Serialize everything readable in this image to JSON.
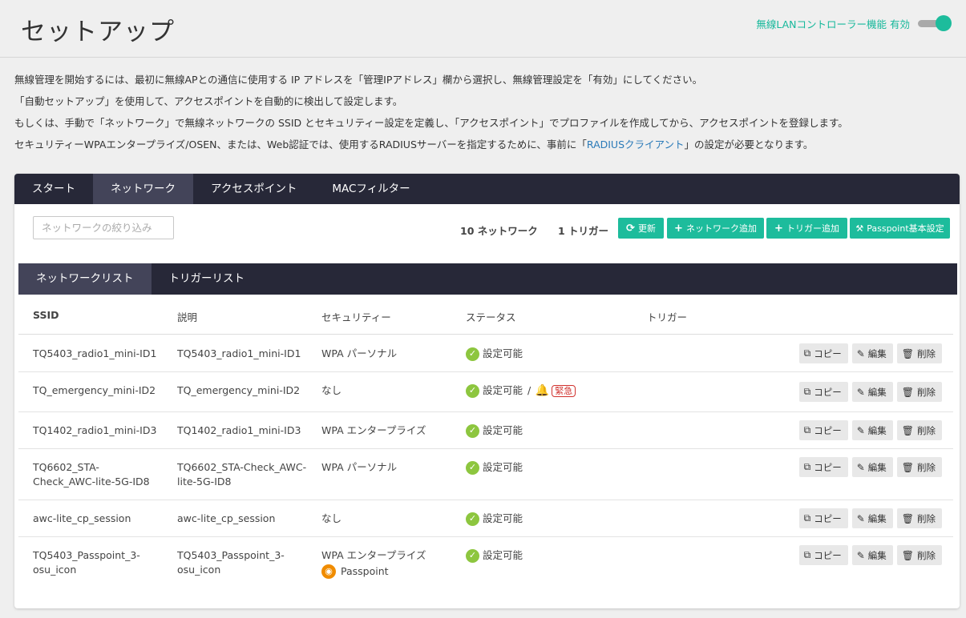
{
  "header": {
    "title": "セットアップ",
    "controller_label": "無線LANコントローラー機能 有効"
  },
  "intro": {
    "line1": "無線管理を開始するには、最初に無線APとの通信に使用する IP アドレスを「管理IPアドレス」欄から選択し、無線管理設定を「有効」にしてください。",
    "line2": "「自動セットアップ」を使用して、アクセスポイントを自動的に検出して設定します。",
    "line3": "もしくは、手動で「ネットワーク」で無線ネットワークの SSID とセキュリティー設定を定義し、「アクセスポイント」でプロファイルを作成してから、アクセスポイントを登録します。",
    "line4_prefix": "セキュリティーWPAエンタープライズ/OSEN、または、Web認証では、使用するRADIUSサーバーを指定するために、事前に「",
    "line4_link": "RADIUSクライアント",
    "line4_suffix": "」の設定が必要となります。"
  },
  "tabs": [
    "スタート",
    "ネットワーク",
    "アクセスポイント",
    "MACフィルター"
  ],
  "toolbar": {
    "filter_placeholder": "ネットワークの絞り込み",
    "network_count": "10 ネットワーク",
    "trigger_count": "1 トリガー",
    "refresh": "更新",
    "add_network": "ネットワーク追加",
    "add_trigger": "トリガー追加",
    "passpoint": "Passpoint基本設定"
  },
  "subtabs": [
    "ネットワークリスト",
    "トリガーリスト"
  ],
  "columns": {
    "ssid": "SSID",
    "desc": "説明",
    "security": "セキュリティー",
    "status": "ステータス",
    "trigger": "トリガー"
  },
  "actions": {
    "copy": "コピー",
    "edit": "編集",
    "delete": "削除"
  },
  "rows": [
    {
      "ssid": "TQ5403_radio1_mini-ID1",
      "desc": "TQ5403_radio1_mini-ID1",
      "security": "WPA パーソナル",
      "status": "設定可能"
    },
    {
      "ssid": "TQ_emergency_mini-ID2",
      "desc": "TQ_emergency_mini-ID2",
      "security": "なし",
      "status": "設定可能",
      "slash": "/",
      "emergency": "緊急"
    },
    {
      "ssid": "TQ1402_radio1_mini-ID3",
      "desc": "TQ1402_radio1_mini-ID3",
      "security": "WPA エンタープライズ",
      "status": "設定可能"
    },
    {
      "ssid": "TQ6602_STA-Check_AWC-lite-5G-ID8",
      "desc": "TQ6602_STA-Check_AWC-lite-5G-ID8",
      "security": "WPA パーソナル",
      "status": "設定可能"
    },
    {
      "ssid": "awc-lite_cp_session",
      "desc": "awc-lite_cp_session",
      "security": "なし",
      "status": "設定可能"
    },
    {
      "ssid": "TQ5403_Passpoint_3-osu_icon",
      "desc": "TQ5403_Passpoint_3-osu_icon",
      "security": "WPA エンタープライズ",
      "security_extra": "Passpoint",
      "status": "設定可能"
    }
  ],
  "colors": {
    "accent": "#1dbc9c",
    "tab_bar": "#272838",
    "tab_active": "#434459",
    "ok_green": "#8dc63f",
    "emergency_red": "#d0312d",
    "passpoint_orange": "#f08c00"
  }
}
